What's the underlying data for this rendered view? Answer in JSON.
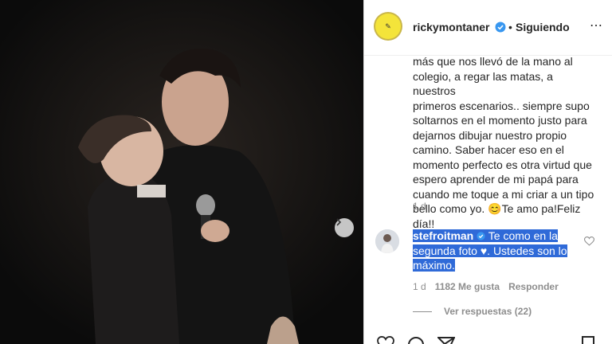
{
  "post": {
    "username": "rickymontaner",
    "separator": "•",
    "follow_status": "Siguiendo",
    "more_icon": "⋯",
    "caption_lines": [
      "más que nos llevó de la mano al",
      "colegio, a regar las matas, a nuestros",
      "primeros escenarios.. siempre supo",
      "soltarnos en el momento justo para",
      "dejarnos dibujar nuestro propio",
      "camino. Saber hacer eso en el",
      "momento perfecto es otra virtud que",
      "espero aprender de mi papá para",
      "cuando me toque a mi criar a un tipo",
      "bello como yo. 😊Te amo pa!Feliz día!!"
    ],
    "caption_time": "1 d"
  },
  "comment": {
    "username": "stefroitman",
    "text": "Te como en la segunda foto ♥. Ustedes son lo máximo.",
    "time": "1 d",
    "likes": "1182 Me gusta",
    "reply": "Responder",
    "view_replies": "Ver respuestas (22)"
  },
  "colors": {
    "accent": "#3897f0",
    "selection": "#2f6ad8",
    "avatar_bg": "#f4e43a"
  }
}
